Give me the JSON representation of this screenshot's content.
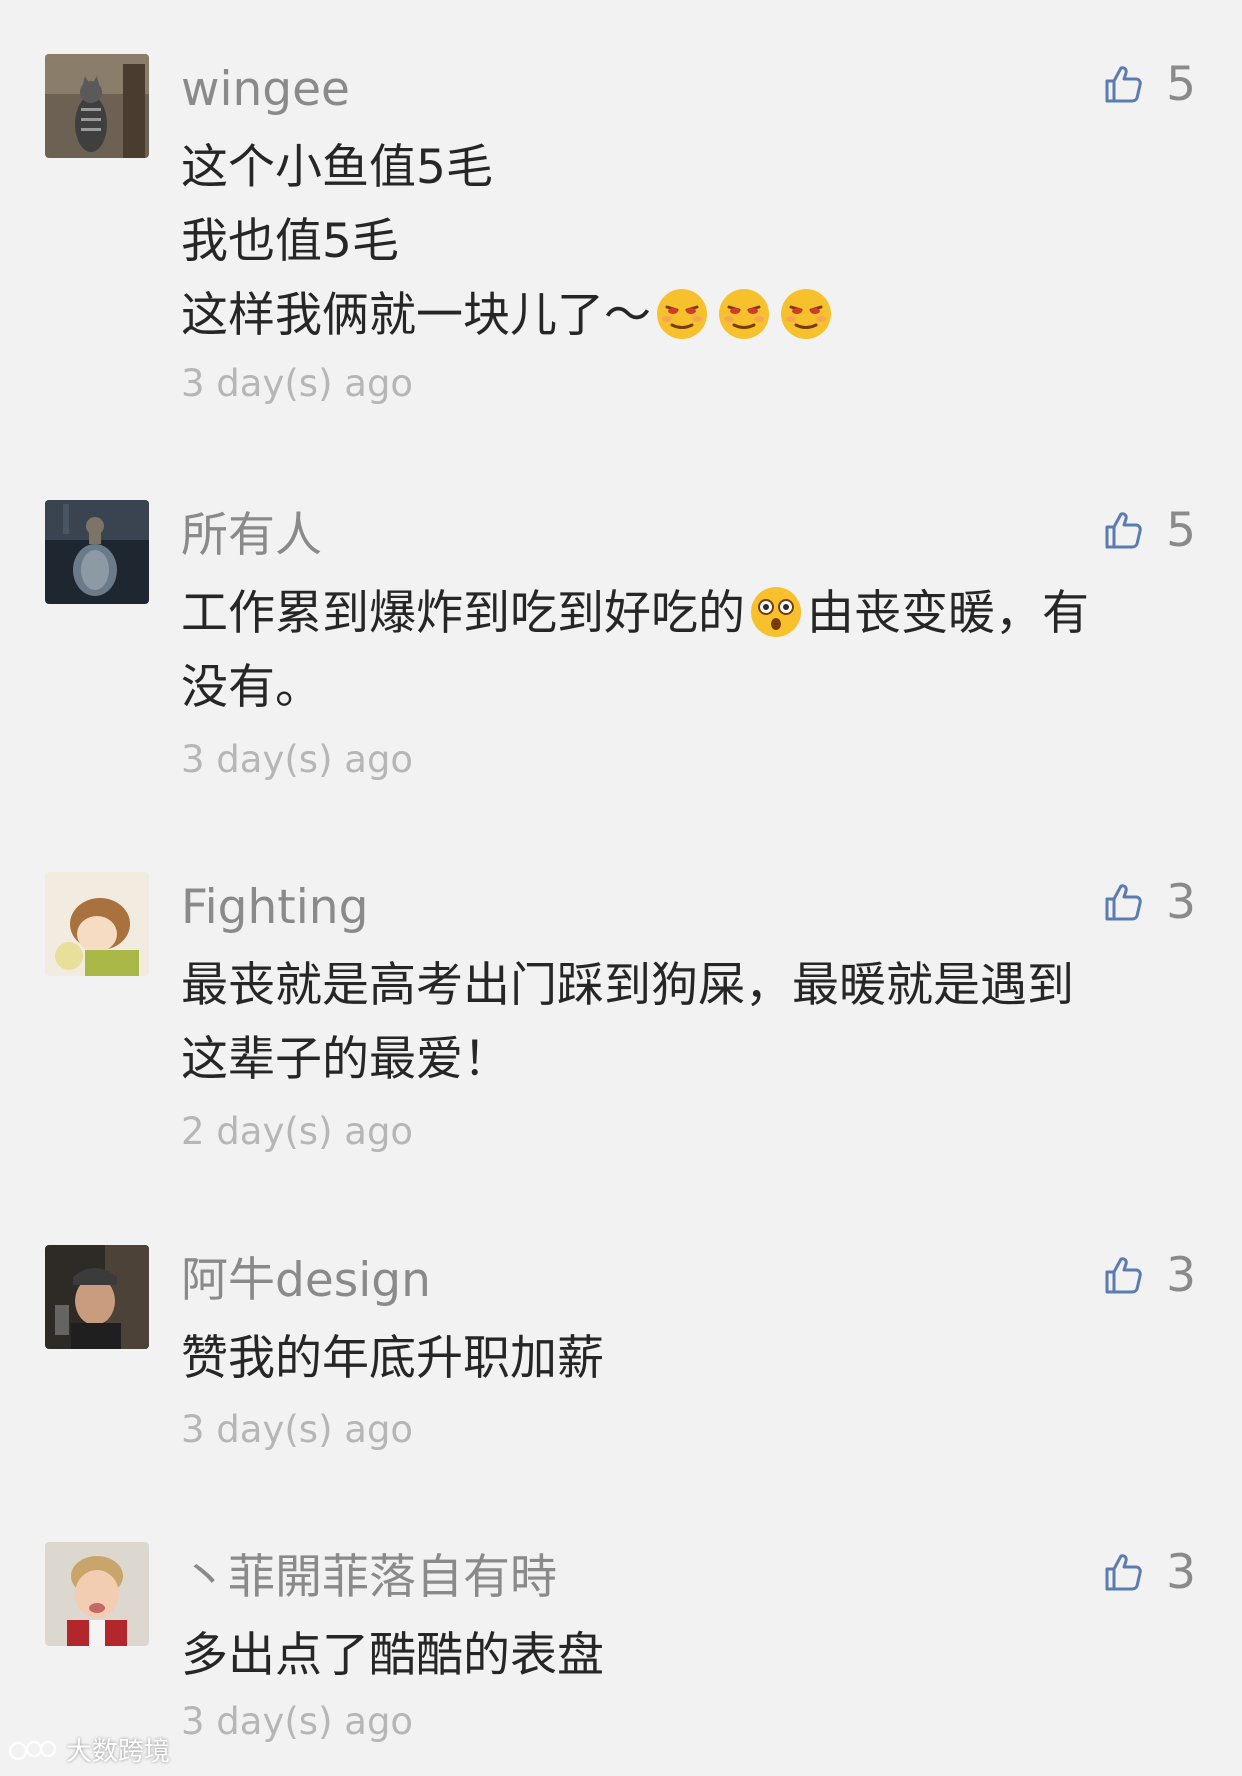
{
  "comments": [
    {
      "username": "wingee",
      "likes": "5",
      "lines": [
        "这个小鱼值5毛",
        "我也值5毛",
        "这样我俩就一块儿了～"
      ],
      "time": "3 day(s) ago"
    },
    {
      "username": "所有人",
      "likes": "5",
      "lines_a": [
        "工作累到爆炸到吃到好吃的",
        "由丧变暖，有"
      ],
      "line_2": "没有。",
      "time": "3 day(s) ago"
    },
    {
      "username": "Fighting",
      "likes": "3",
      "lines": [
        "最丧就是高考出门踩到狗屎，最暖就是遇到",
        "这辈子的最爱！"
      ],
      "time": "2 day(s) ago"
    },
    {
      "username": "阿牛design",
      "likes": "3",
      "lines": [
        "赞我的年底升职加薪"
      ],
      "time": "3 day(s) ago"
    },
    {
      "username": "丶菲開菲落自有時",
      "likes": "3",
      "lines": [
        "多出点了酷酷的表盘"
      ],
      "time": "3 day(s) ago"
    }
  ],
  "colors": {
    "background": "#f2f2f2",
    "username": "#8a8a8a",
    "text": "#262626",
    "time": "#b6b6b6",
    "like_icon": "#5b7cb0"
  },
  "watermark": "大数跨境"
}
